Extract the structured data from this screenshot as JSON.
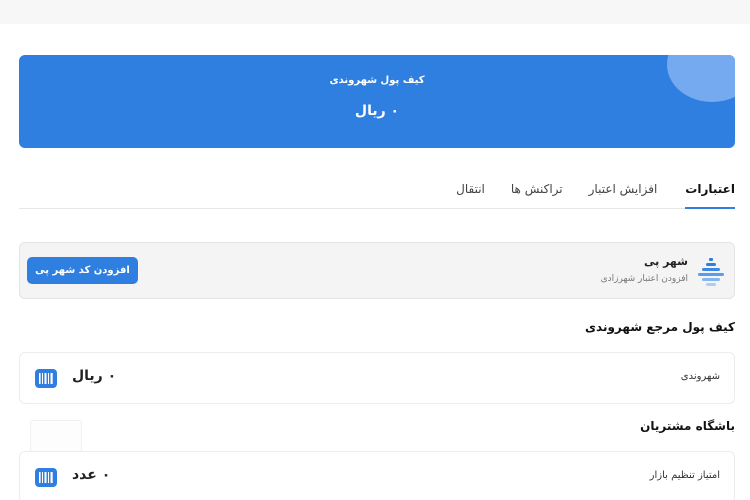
{
  "wallet": {
    "title": "کیف پول شهروندی",
    "amount": "۰ ریال"
  },
  "tabs": [
    {
      "label": "اعتبارات",
      "active": true
    },
    {
      "label": "افزایش اعتبار",
      "active": false
    },
    {
      "label": "تراکنش ها",
      "active": false
    },
    {
      "label": "انتقال",
      "active": false
    }
  ],
  "shahrpay": {
    "title": "شهر پی",
    "subtitle": "افزودن اعتبار شهرزادی",
    "button_label": "افزودن کد شهر پی",
    "logo_icon": "shahrpay-logo-icon"
  },
  "sections": {
    "citizen_wallet": {
      "title": "کیف پول مرجع شهروندی",
      "row_label": "شهروندی",
      "row_value": "۰ ریال",
      "icon": "barcode-icon"
    },
    "customer_club": {
      "title": "باشگاه مشتریان",
      "row_label": "امتیاز تنظیم بازار",
      "row_value": "۰ عدد",
      "icon": "barcode-icon"
    }
  },
  "colors": {
    "accent": "#2f7fe0",
    "accent_light": "#76aaf0",
    "panel_bg": "#f4f4f5"
  }
}
